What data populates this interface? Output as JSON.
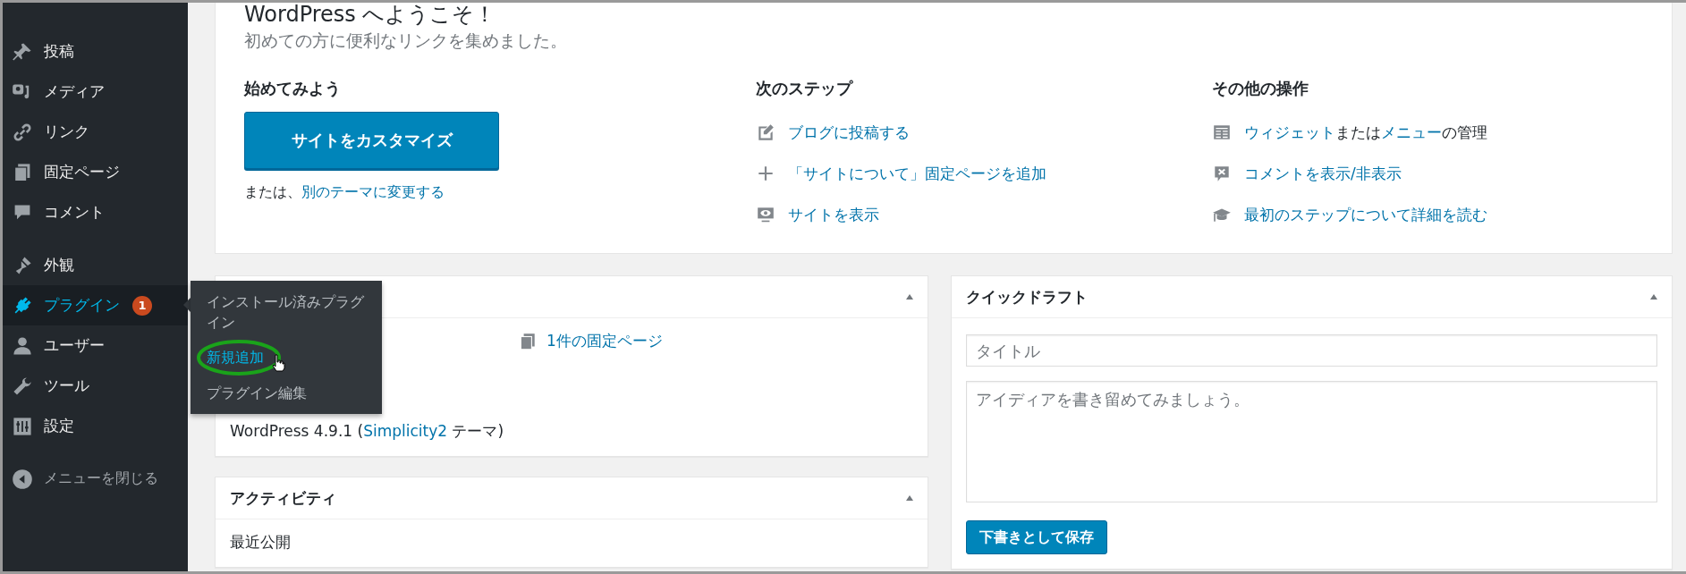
{
  "sidebar": {
    "groups": [
      [
        {
          "label": "投稿",
          "selected": false
        },
        {
          "label": "メディア",
          "selected": false
        },
        {
          "label": "リンク",
          "selected": false
        },
        {
          "label": "固定ページ",
          "selected": false
        },
        {
          "label": "コメント",
          "selected": false
        }
      ],
      [
        {
          "label": "外観",
          "selected": false
        },
        {
          "label": "プラグイン",
          "selected": true,
          "badge": "1"
        },
        {
          "label": "ユーザー",
          "selected": false
        },
        {
          "label": "ツール",
          "selected": false
        },
        {
          "label": "設定",
          "selected": false
        }
      ]
    ],
    "collapse_label": "メニューを閉じる",
    "flyout": {
      "items": [
        {
          "label": "インストール済みプラグイン",
          "selected": false
        },
        {
          "label": "新規追加",
          "selected": true
        },
        {
          "label": "プラグイン編集",
          "selected": false
        }
      ]
    }
  },
  "welcome": {
    "title": "WordPress へようこそ！",
    "subtitle": "初めての方に便利なリンクを集めました。",
    "columns": [
      {
        "heading": "始めてみよう",
        "button": "サイトをカスタマイズ",
        "alt": [
          {
            "text": "または、",
            "kind": "text"
          },
          {
            "text": "別のテーマに変更する",
            "kind": "link"
          }
        ]
      },
      {
        "heading": "次のステップ",
        "links": [
          [
            {
              "text": "ブログに投稿する",
              "kind": "link"
            }
          ],
          [
            {
              "text": "「サイトについて」固定ページを追加",
              "kind": "link"
            }
          ],
          [
            {
              "text": "サイトを表示",
              "kind": "link"
            }
          ]
        ]
      },
      {
        "heading": "その他の操作",
        "links": [
          [
            {
              "text": "ウィジェット",
              "kind": "link"
            },
            {
              "text": "または",
              "kind": "text"
            },
            {
              "text": "メニュー",
              "kind": "link"
            },
            {
              "text": "の管理",
              "kind": "text"
            }
          ],
          [
            {
              "text": "コメントを表示/非表示",
              "kind": "link"
            }
          ],
          [
            {
              "text": "最初のステップについて詳細を読む",
              "kind": "link"
            }
          ]
        ]
      }
    ]
  },
  "glance": {
    "items": [
      "1件の固定ページ"
    ],
    "theme_line": [
      {
        "text": "WordPress 4.9.1 (",
        "kind": "text"
      },
      {
        "text": "Simplicity2",
        "kind": "link"
      },
      {
        "text": " テーマ)",
        "kind": "text"
      }
    ]
  },
  "activity": {
    "title": "アクティビティ",
    "subheading": "最近公開"
  },
  "quick_draft": {
    "title": "クイックドラフト",
    "title_placeholder": "タイトル",
    "content_placeholder": "アイディアを書き留めてみましょう。",
    "button": "下書きとして保存"
  }
}
